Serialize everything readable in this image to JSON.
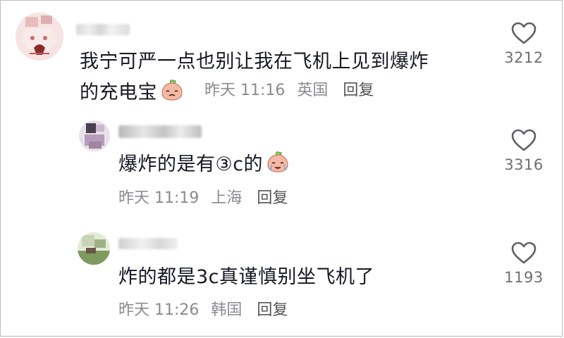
{
  "comments": [
    {
      "text_line1": "我宁可严一点也别让我在飞机上见到爆炸",
      "text_line2": "的充电宝",
      "emoji": "crying-face-emoji",
      "time": "昨天 11:16",
      "location": "英国",
      "reply_label": "回复",
      "likes": "3212"
    },
    {
      "text": "爆炸的是有③c的",
      "emoji": "crying-face-emoji",
      "time": "昨天 11:19",
      "location": "上海",
      "reply_label": "回复",
      "likes": "3316"
    },
    {
      "text": "炸的都是3c真谨慎别坐飞机了",
      "time": "昨天 11:26",
      "location": "韩国",
      "reply_label": "回复",
      "likes": "1193"
    }
  ],
  "colors": {
    "text": "#161823",
    "meta": "#8a8b91",
    "icon_stroke": "#5f6067"
  }
}
